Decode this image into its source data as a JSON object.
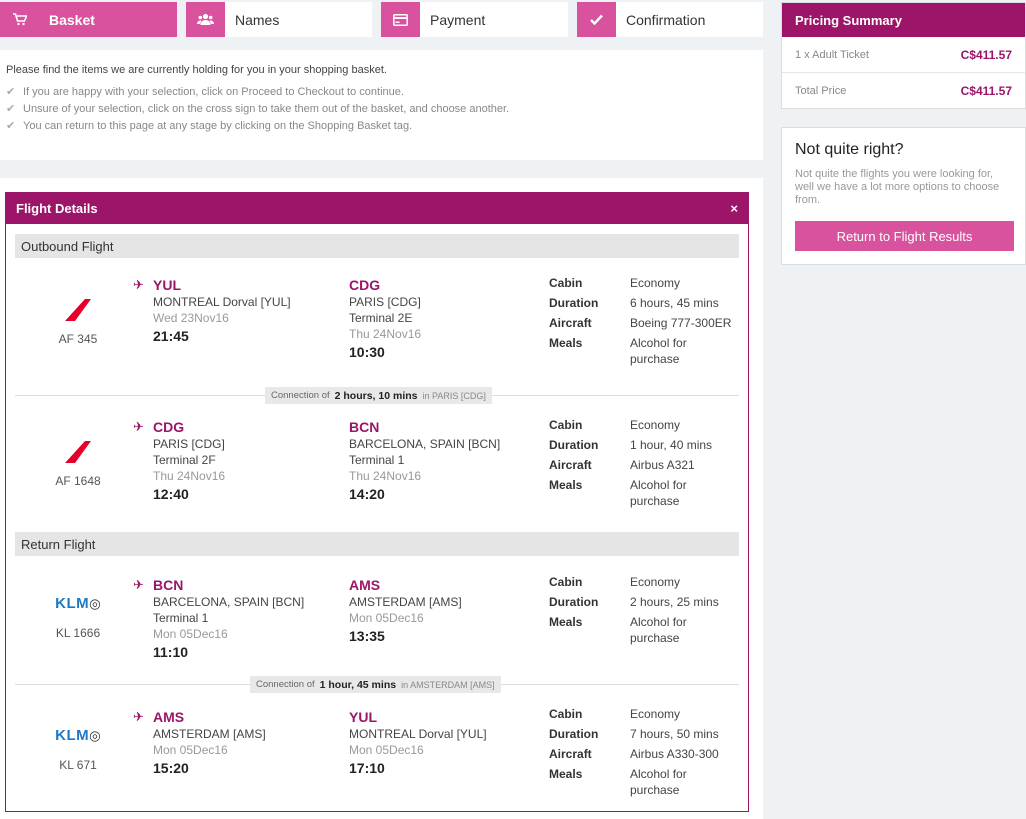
{
  "steps": [
    {
      "label": "Basket",
      "icon": "cart-icon"
    },
    {
      "label": "Names",
      "icon": "users-icon"
    },
    {
      "label": "Payment",
      "icon": "credit-card-icon"
    },
    {
      "label": "Confirmation",
      "icon": "check-icon"
    }
  ],
  "intro": {
    "text": "Please find the items we are currently holding for you in your shopping basket.",
    "bullets": [
      "If you are happy with your selection, click on Proceed to Checkout to continue.",
      "Unsure of your selection, click on the cross sign to take them out of the basket, and choose another.",
      "You can return to this page at any stage by clicking on the Shopping Basket tag."
    ]
  },
  "flight_details": {
    "title": "Flight Details",
    "close": "×",
    "outbound_title": "Outbound Flight",
    "return_title": "Return Flight",
    "connection_prefix": "Connection of",
    "segments": [
      {
        "airline": "air-france",
        "flight_no": "AF 345",
        "dep": {
          "code": "YUL",
          "city": "MONTREAL Dorval [YUL]",
          "terminal": "",
          "date": "Wed 23Nov16",
          "time": "21:45"
        },
        "arr": {
          "code": "CDG",
          "city": "PARIS [CDG]",
          "terminal": "Terminal 2E",
          "date": "Thu 24Nov16",
          "time": "10:30"
        },
        "details": [
          {
            "k": "Cabin",
            "v": "Economy"
          },
          {
            "k": "Duration",
            "v": "6 hours, 45 mins"
          },
          {
            "k": "Aircraft",
            "v": "Boeing 777-300ER"
          },
          {
            "k": "Meals",
            "v": "Alcohol for purchase"
          }
        ]
      },
      {
        "airline": "air-france",
        "flight_no": "AF 1648",
        "dep": {
          "code": "CDG",
          "city": "PARIS [CDG]",
          "terminal": "Terminal 2F",
          "date": "Thu 24Nov16",
          "time": "12:40"
        },
        "arr": {
          "code": "BCN",
          "city": "BARCELONA, SPAIN [BCN]",
          "terminal": "Terminal 1",
          "date": "Thu 24Nov16",
          "time": "14:20"
        },
        "details": [
          {
            "k": "Cabin",
            "v": "Economy"
          },
          {
            "k": "Duration",
            "v": "1 hour, 40 mins"
          },
          {
            "k": "Aircraft",
            "v": "Airbus A321"
          },
          {
            "k": "Meals",
            "v": "Alcohol for purchase"
          }
        ]
      },
      {
        "airline": "klm",
        "flight_no": "KL 1666",
        "dep": {
          "code": "BCN",
          "city": "BARCELONA, SPAIN [BCN]",
          "terminal": "Terminal 1",
          "date": "Mon 05Dec16",
          "time": "11:10"
        },
        "arr": {
          "code": "AMS",
          "city": "AMSTERDAM [AMS]",
          "terminal": "",
          "date": "Mon 05Dec16",
          "time": "13:35"
        },
        "details": [
          {
            "k": "Cabin",
            "v": "Economy"
          },
          {
            "k": "Duration",
            "v": "2 hours, 25 mins"
          },
          {
            "k": "Meals",
            "v": "Alcohol for purchase"
          }
        ]
      },
      {
        "airline": "klm",
        "flight_no": "KL 671",
        "dep": {
          "code": "AMS",
          "city": "AMSTERDAM [AMS]",
          "terminal": "",
          "date": "Mon 05Dec16",
          "time": "15:20"
        },
        "arr": {
          "code": "YUL",
          "city": "MONTREAL Dorval [YUL]",
          "terminal": "",
          "date": "Mon 05Dec16",
          "time": "17:10"
        },
        "details": [
          {
            "k": "Cabin",
            "v": "Economy"
          },
          {
            "k": "Duration",
            "v": "7 hours, 50 mins"
          },
          {
            "k": "Aircraft",
            "v": "Airbus A330-300"
          },
          {
            "k": "Meals",
            "v": "Alcohol for purchase"
          }
        ]
      }
    ],
    "connections": [
      {
        "duration": "2 hours, 10 mins",
        "location": "in PARIS [CDG]"
      },
      {
        "duration": "1 hour, 45 mins",
        "location": "in AMSTERDAM [AMS]"
      }
    ],
    "klm_text": "KLM"
  },
  "pricing": {
    "title": "Pricing Summary",
    "rows": [
      {
        "label": "1 x Adult Ticket",
        "amount": "C$411.57"
      },
      {
        "label": "Total Price",
        "amount": "C$411.57"
      }
    ]
  },
  "not_quite": {
    "title": "Not quite right?",
    "text": "Not quite the flights you were looking for, well we have a lot more options to choose from.",
    "button": "Return to Flight Results"
  },
  "colors": {
    "brand": "#9c1568",
    "accent": "#d9529d"
  }
}
